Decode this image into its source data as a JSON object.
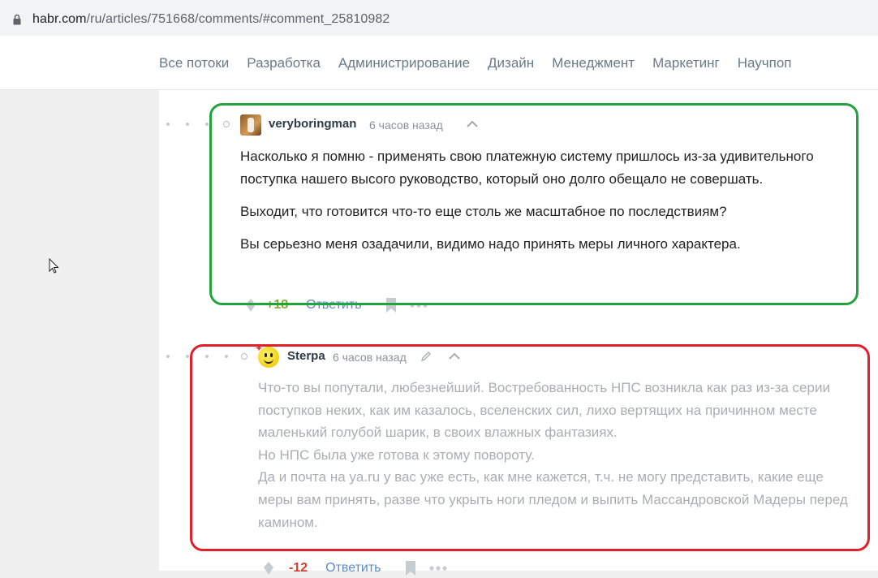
{
  "browser": {
    "url_host": "habr.com",
    "url_path": "/ru/articles/751668/comments/#comment_25810982"
  },
  "nav": {
    "items": [
      "Все потоки",
      "Разработка",
      "Администрирование",
      "Дизайн",
      "Менеджмент",
      "Маркетинг",
      "Научпоп"
    ]
  },
  "comments": [
    {
      "username": "veryboringman",
      "time": "6 часов назад",
      "paragraphs": [
        "Насколько я помню - применять свою платежную систему пришлось из-за удивительного поступка нашего высого руководство, который оно долго обещало не совершать.",
        "Выходит, что готовится что-то еще столь же масштабное по последствиям?",
        "Вы серьезно меня озадачили, видимо надо принять меры личного характера."
      ],
      "score": "+18",
      "reply_label": "Ответить"
    },
    {
      "username": "Sterpa",
      "time": "6 часов назад",
      "lines": [
        "Что-то вы попутали, любезнейший. Востребованность НПС возникла как раз из-за серии поступков неких, как им казалось, вселенских сил, лихо вертящих на причинном месте маленький голубой шарик, в своих влажных фантазиях.",
        "Но НПС была уже готова к этому повороту.",
        "Да и почта на ya.ru у вас уже есть, как мне кажется, т.ч. не могу представить, какие еще меры вам принять, разве что укрыть ноги пледом и выпить Массандровской Мадеры перед камином."
      ],
      "score": "-12",
      "reply_label": "Ответить"
    }
  ],
  "highlight_colors": {
    "first": "#22a33c",
    "second": "#e0202a"
  }
}
